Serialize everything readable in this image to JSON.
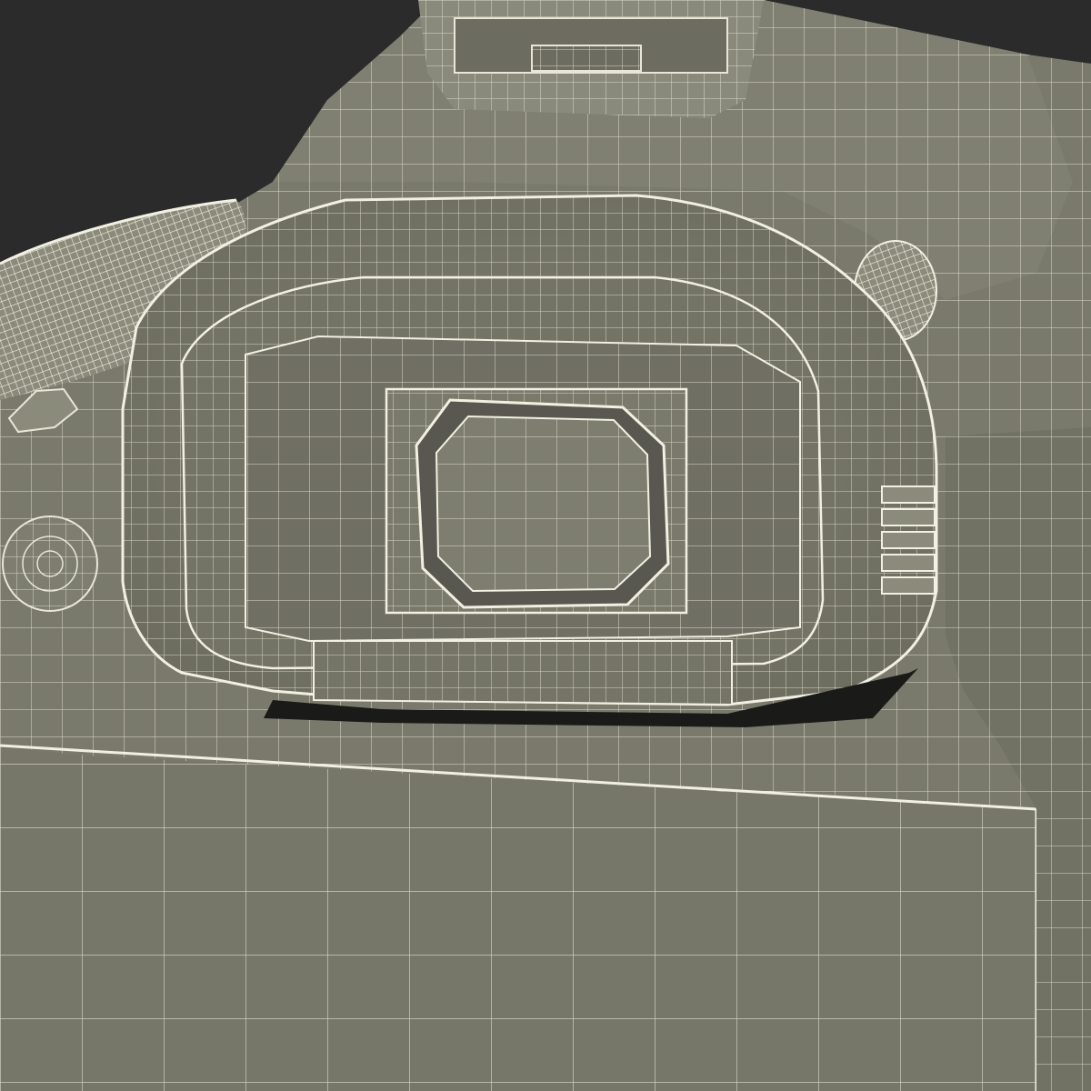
{
  "scene": {
    "subject": "camera-wireframe-render",
    "colors": {
      "background": "#2b2b2b",
      "surface": "#7a7a6c",
      "surface_light": "#8b8b7b",
      "surface_dark": "#5f5f53",
      "wire": "#e8e6d6",
      "shadow": "#1a1a18"
    },
    "icons": [
      "viewfinder-eyecup-icon",
      "hot-shoe-icon",
      "diopter-dial-icon",
      "mode-dial-icon",
      "button-left-icon",
      "button-right-icon"
    ]
  }
}
